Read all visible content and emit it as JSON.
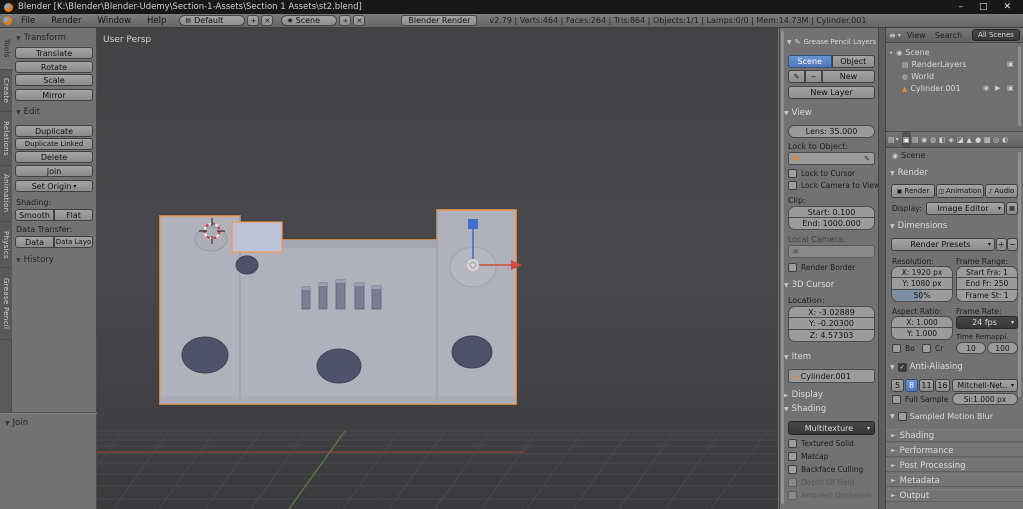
{
  "icons": {
    "expanded": "▼",
    "collapsed": "►",
    "check": "✓",
    "menu_arrow": "▾",
    "plus": "+",
    "minus": "−",
    "close": "✕",
    "minimize": "–",
    "maximize": "□",
    "pencil": "✎",
    "eyedropper": "✎",
    "editor_list": "≡",
    "editor_props": "▤",
    "camera": "▣",
    "eye": "◉",
    "cursor_arrow": "▶",
    "dot": "•",
    "audio": "♪",
    "clapper": "◫",
    "screen": "▦",
    "cube": "■",
    "scene": "◉",
    "image": "▤",
    "world": "◍",
    "mesh": "▲"
  },
  "titlebar": {
    "title": "Blender [K:\\Blender\\Blender-Udemy\\Section-1-Assets\\Section 1 Assets\\st2.blend]"
  },
  "menubar": {
    "menus": [
      "File",
      "Render",
      "Window",
      "Help"
    ],
    "layout": "Default",
    "scene": "Scene",
    "engine": "Blender Render",
    "stats": "v2.79 | Verts:464 | Faces:264 | Tris:864 | Objects:1/1 | Lamps:0/0 | Mem:14.73M | Cylinder.001"
  },
  "toolshelf": {
    "tabs": [
      "Tools",
      "Create",
      "Relations",
      "Animation",
      "Physics",
      "Grease Pencil"
    ],
    "transform_title": "Transform",
    "buttons": {
      "translate": "Translate",
      "rotate": "Rotate",
      "scale": "Scale",
      "mirror": "Mirror"
    },
    "edit_title": "Edit",
    "edit_buttons": {
      "duplicate": "Duplicate",
      "duplicate_linked": "Duplicate Linked",
      "delete": "Delete",
      "join": "Join",
      "set_origin": "Set Origin"
    },
    "shading_label": "Shading:",
    "shading_buttons": {
      "smooth": "Smooth",
      "flat": "Flat"
    },
    "data_transfer_label": "Data Transfer:",
    "data_buttons": {
      "data": "Data",
      "data_layout": "Data Layo"
    },
    "history_title": "History",
    "operator_panel_title": "Join"
  },
  "viewport": {
    "label": "User Persp"
  },
  "npanel": {
    "gp_title": "Grease Pencil Layers",
    "gp_source_scene": "Scene",
    "gp_source_object": "Object",
    "gp_new": "New",
    "gp_new_layer": "New Layer",
    "view_title": "View",
    "lens": "Lens: 35.000",
    "lock_to_object_label": "Lock to Object:",
    "lock_to_cursor": "Lock to Cursor",
    "lock_camera_to_view": "Lock Camera to View",
    "clip_label": "Clip:",
    "clip_start": "Start: 0.100",
    "clip_end": "End: 1000.000",
    "local_camera_label": "Local Camera:",
    "render_border": "Render Border",
    "cursor_title": "3D Cursor",
    "location_label": "Location:",
    "cursor_x": "X: -3.02889",
    "cursor_y": "Y: -0.20300",
    "cursor_z": "Z: 4.57303",
    "item_title": "Item",
    "item_name": "Cylinder.001",
    "display_title": "Display",
    "shading_title": "Shading",
    "shading_mode": "Multitexture",
    "textured_solid": "Textured Solid",
    "matcap": "Matcap",
    "backface_culling": "Backface Culling",
    "depth_of_field": "Depth Of Field",
    "ambient_occlusion": "Ambient Occlusion"
  },
  "outliner": {
    "view_menu": "View",
    "search_menu": "Search",
    "filter": "All Scenes",
    "items": [
      {
        "label": "Scene"
      },
      {
        "label": "RenderLayers"
      },
      {
        "label": "World"
      },
      {
        "label": "Cylinder.001"
      }
    ]
  },
  "properties": {
    "tabs": [
      {
        "name": "render",
        "glyph": "▣"
      },
      {
        "name": "render-layers",
        "glyph": "▤"
      },
      {
        "name": "scene",
        "glyph": "◉"
      },
      {
        "name": "world",
        "glyph": "◍"
      },
      {
        "name": "object",
        "glyph": "◧"
      },
      {
        "name": "constraints",
        "glyph": "◈"
      },
      {
        "name": "modifiers",
        "glyph": "◪"
      },
      {
        "name": "data",
        "glyph": "▲"
      },
      {
        "name": "material",
        "glyph": "●"
      },
      {
        "name": "texture",
        "glyph": "▩"
      },
      {
        "name": "particles",
        "glyph": "◎"
      },
      {
        "name": "physics",
        "glyph": "◐"
      }
    ],
    "context": "Scene",
    "render_title": "Render",
    "render_button": "Render",
    "animation_button": "Animation",
    "audio_button": "Audio",
    "display_label": "Display:",
    "display_value": "Image Editor",
    "dimensions_title": "Dimensions",
    "presets": "Render Presets",
    "resolution_label": "Resolution:",
    "frame_range_label": "Frame Range:",
    "res_x": "X: 1920 px",
    "res_y": "Y: 1080 px",
    "res_pct": "50%",
    "frame_start": "Start Fra: 1",
    "frame_end": "End Fr: 250",
    "frame_step": "Frame St: 1",
    "aspect_label": "Aspect Ratio:",
    "frame_rate_label": "Frame Rate:",
    "aspect_x": "X: 1.000",
    "aspect_y": "Y: 1.000",
    "fps": "24 fps",
    "border_cb": "Bo",
    "crop_cb": "Cr",
    "time_remap_label": "Time Remappi.",
    "remap_old": "10",
    "remap_new": "100",
    "aa_title": "Anti-Aliasing",
    "aa_samples": [
      "5",
      "8",
      "11",
      "16"
    ],
    "aa_filter": "Mitchell-Net..",
    "full_sample": "Full Sample",
    "aa_size": "Si:1.000 px",
    "smb_title": "Sampled Motion Blur",
    "shading_title": "Shading",
    "performance_title": "Performance",
    "post_title": "Post Processing",
    "metadata_title": "Metadata",
    "output_title": "Output"
  }
}
